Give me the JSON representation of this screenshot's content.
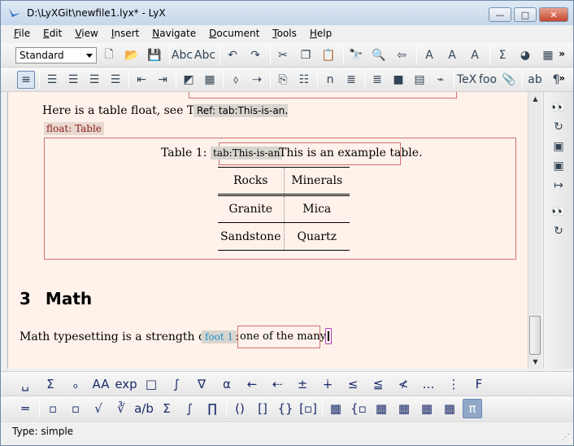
{
  "window": {
    "title": "D:\\LyXGit\\newfile1.lyx* - LyX",
    "minimize": "—",
    "maximize": "□",
    "close": "✕"
  },
  "menu": [
    {
      "label": "File",
      "key": "F",
      "rest": "ile"
    },
    {
      "label": "Edit",
      "key": "E",
      "rest": "dit"
    },
    {
      "label": "View",
      "key": "V",
      "rest": "iew"
    },
    {
      "label": "Insert",
      "key": "I",
      "rest": "nsert"
    },
    {
      "label": "Navigate",
      "key": "N",
      "rest": "avigate"
    },
    {
      "label": "Document",
      "key": "D",
      "rest": "ocument"
    },
    {
      "label": "Tools",
      "key": "T",
      "rest": "ools"
    },
    {
      "label": "Help",
      "key": "H",
      "rest": "elp"
    }
  ],
  "toolbar": {
    "layout_value": "Standard",
    "more": "»",
    "icons1": [
      {
        "name": "new-document-icon",
        "glyph": "🗋"
      },
      {
        "name": "open-folder-icon",
        "glyph": "📂"
      },
      {
        "name": "save-icon",
        "glyph": "💾"
      },
      {
        "name": "spellcheck-icon",
        "glyph": "Abc"
      },
      {
        "name": "spellcheck-continuous-icon",
        "glyph": "Abc"
      },
      {
        "name": "undo-icon",
        "glyph": "↶"
      },
      {
        "name": "redo-icon",
        "glyph": "↷"
      },
      {
        "name": "cut-icon",
        "glyph": "✂"
      },
      {
        "name": "copy-icon",
        "glyph": "❐"
      },
      {
        "name": "paste-icon",
        "glyph": "📋"
      },
      {
        "name": "find-icon",
        "glyph": "🔭"
      },
      {
        "name": "search-icon",
        "glyph": "🔍"
      },
      {
        "name": "back-arrow-icon",
        "glyph": "⇦"
      },
      {
        "name": "text-style-icon",
        "glyph": "A"
      },
      {
        "name": "text-style-apply-icon",
        "glyph": "A"
      },
      {
        "name": "text-style-paint-icon",
        "glyph": "A"
      },
      {
        "name": "math-sigma-icon",
        "glyph": "Σ"
      },
      {
        "name": "insert-graphics-icon",
        "glyph": "◕"
      },
      {
        "name": "insert-table-icon",
        "glyph": "▦"
      }
    ],
    "icons2": [
      {
        "name": "paragraph-standard-icon",
        "glyph": "≡"
      },
      {
        "name": "list-enumerate-icon",
        "glyph": "☰"
      },
      {
        "name": "list-itemize-icon",
        "glyph": "☰"
      },
      {
        "name": "list-description-icon",
        "glyph": "☰"
      },
      {
        "name": "list-nested-icon",
        "glyph": "☰"
      },
      {
        "name": "indent-decrease-icon",
        "glyph": "⇤"
      },
      {
        "name": "indent-increase-icon",
        "glyph": "⇥"
      },
      {
        "name": "insert-figure-float-icon",
        "glyph": "◩"
      },
      {
        "name": "insert-table-float-icon",
        "glyph": "▦"
      },
      {
        "name": "insert-label-icon",
        "glyph": "⬨"
      },
      {
        "name": "insert-cross-ref-icon",
        "glyph": "⇢"
      },
      {
        "name": "insert-citation-icon",
        "glyph": "⎘"
      },
      {
        "name": "insert-index-icon",
        "glyph": "☷"
      },
      {
        "name": "insert-nomenclature-icon",
        "glyph": "n"
      },
      {
        "name": "insert-footnote-icon",
        "glyph": "≣"
      },
      {
        "name": "insert-margin-note-icon",
        "glyph": "≣"
      },
      {
        "name": "insert-note-icon",
        "glyph": "■"
      },
      {
        "name": "insert-box-icon",
        "glyph": "▤"
      },
      {
        "name": "insert-hyperlink-icon",
        "glyph": "⌁"
      },
      {
        "name": "insert-tex-code-icon",
        "glyph": "TeX"
      },
      {
        "name": "insert-foot-icon",
        "glyph": "foo"
      },
      {
        "name": "insert-attachment-icon",
        "glyph": "📎"
      },
      {
        "name": "change-case-icon",
        "glyph": "ab"
      },
      {
        "name": "paragraph-settings-icon",
        "glyph": "¶"
      }
    ]
  },
  "document": {
    "para1": "Here is a table float, see Table",
    "ref_inset": "Ref: tab:This-is-an",
    "para1_end": ".",
    "float_label": "float: Table",
    "caption_prefix": "Table 1:",
    "caption_label": "tab:This-is-an",
    "caption_text": "This is an example table.",
    "table": [
      [
        "Rocks",
        "Minerals"
      ],
      [
        "Granite",
        "Mica"
      ],
      [
        "Sandstone",
        "Quartz"
      ]
    ],
    "section_num": "3",
    "section_title": "Math",
    "math_text": "Math typesetting is a strength of LyX:",
    "foot_inset": "foot 1",
    "foot_text": "one of the many!"
  },
  "right_toolbar": [
    {
      "name": "view-icon",
      "glyph": "👀"
    },
    {
      "name": "update-icon",
      "glyph": "↻"
    },
    {
      "name": "view-other-icon",
      "glyph": "▣"
    },
    {
      "name": "update-other-icon",
      "glyph": "▣"
    },
    {
      "name": "export-icon",
      "glyph": "↦"
    },
    {
      "name": "view-master-icon",
      "glyph": "👀"
    },
    {
      "name": "update-master-icon",
      "glyph": "↻"
    }
  ],
  "math_toolbar1": [
    {
      "name": "math-space-icon",
      "glyph": "␣"
    },
    {
      "name": "math-sum-icon",
      "glyph": "Σ"
    },
    {
      "name": "math-subscript-icon",
      "glyph": "ₒ"
    },
    {
      "name": "math-font-icon",
      "glyph": "AA"
    },
    {
      "name": "math-exp-tag-icon",
      "glyph": "exp"
    },
    {
      "name": "math-frame-icon",
      "glyph": "□"
    },
    {
      "name": "math-integral-limits-icon",
      "glyph": "∫"
    },
    {
      "name": "math-nabla-icon",
      "glyph": "∇"
    },
    {
      "name": "math-alpha-icon",
      "glyph": "α"
    },
    {
      "name": "math-left-arrow-icon",
      "glyph": "←"
    },
    {
      "name": "math-dotted-arrow-icon",
      "glyph": "⇠"
    },
    {
      "name": "math-plus-minus-icon",
      "glyph": "±"
    },
    {
      "name": "math-dot-plus-icon",
      "glyph": "∔"
    },
    {
      "name": "math-leq-icon",
      "glyph": "≤"
    },
    {
      "name": "math-leqq-icon",
      "glyph": "≦"
    },
    {
      "name": "math-nless-icon",
      "glyph": "≮"
    },
    {
      "name": "math-dots-icon",
      "glyph": "…"
    },
    {
      "name": "math-vdots-icon",
      "glyph": "⋮"
    },
    {
      "name": "math-function-icon",
      "glyph": "F"
    }
  ],
  "math_toolbar2": [
    {
      "name": "math-display-icon",
      "glyph": "═"
    },
    {
      "name": "math-subscript-box-icon",
      "glyph": "▫"
    },
    {
      "name": "math-superscript-box-icon",
      "glyph": "▫"
    },
    {
      "name": "math-sqrt-icon",
      "glyph": "√"
    },
    {
      "name": "math-root-icon",
      "glyph": "∛"
    },
    {
      "name": "math-fraction-icon",
      "glyph": "a/b"
    },
    {
      "name": "math-sum-sym-icon",
      "glyph": "Σ"
    },
    {
      "name": "math-integral-icon",
      "glyph": "∫"
    },
    {
      "name": "math-product-icon",
      "glyph": "∏"
    },
    {
      "name": "math-parens-icon",
      "glyph": "()"
    },
    {
      "name": "math-brackets-icon",
      "glyph": "[]"
    },
    {
      "name": "math-braces-icon",
      "glyph": "{}"
    },
    {
      "name": "math-delimiters-icon",
      "glyph": "[▫]"
    },
    {
      "name": "math-matrix-icon",
      "glyph": "▦"
    },
    {
      "name": "math-cases-icon",
      "glyph": "{▫"
    },
    {
      "name": "math-add-column-icon",
      "glyph": "▦"
    },
    {
      "name": "math-add-row-icon",
      "glyph": "▦"
    },
    {
      "name": "math-delete-column-icon",
      "glyph": "▦"
    },
    {
      "name": "math-delete-row-icon",
      "glyph": "▦"
    },
    {
      "name": "math-panels-icon",
      "glyph": "π"
    }
  ],
  "status": "Type: simple"
}
